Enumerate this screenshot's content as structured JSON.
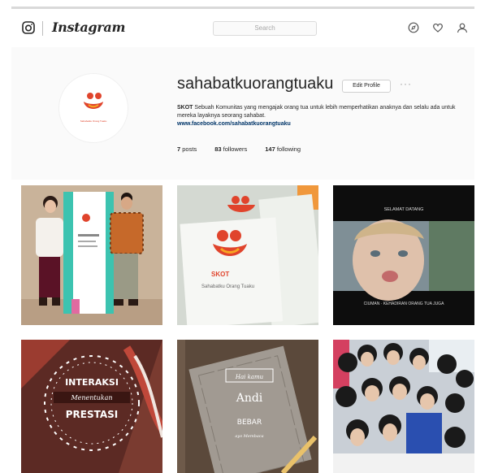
{
  "navbar": {
    "wordmark": "Instagram",
    "search_placeholder": "Search",
    "icons": [
      "camera-icon",
      "compass-icon",
      "heart-icon",
      "user-icon"
    ]
  },
  "profile": {
    "username": "sahabatkuorangtuaku",
    "edit_label": "Edit Profile",
    "options_label": "···",
    "bio_name": "SKOT",
    "bio_text": "Sebuah Komunitas yang mengajak orang tua untuk lebih memperhatikan anaknya dan selalu ada untuk mereka layaknya seorang sahabat.",
    "bio_link": "www.facebook.com/sahabatkuorangtuaku",
    "avatar_caption": "Sahabatku Orang Tuaku",
    "stats": {
      "posts_count": "7",
      "posts_label": "posts",
      "followers_count": "83",
      "followers_label": "followers",
      "following_count": "147",
      "following_label": "following"
    }
  },
  "posts": {
    "card_caption": "Sahabatku Orang Tuaku",
    "tile3_top": "SELAMAT DATANG",
    "tile3_bottom": "CIUMAN · KEHADIRAN ORANG TUA JUGA",
    "tile4_line1": "INTERAKSI",
    "tile4_line2": "Menentukan",
    "tile4_line3": "PRESTASI",
    "tile5_line1": "Hai kamu",
    "tile5_line2": "Andi",
    "tile5_line3": "BEBAR",
    "tile5_line4": "ayo Membaca"
  },
  "colors": {
    "brand_red": "#e0442c",
    "link_blue": "#003569"
  }
}
